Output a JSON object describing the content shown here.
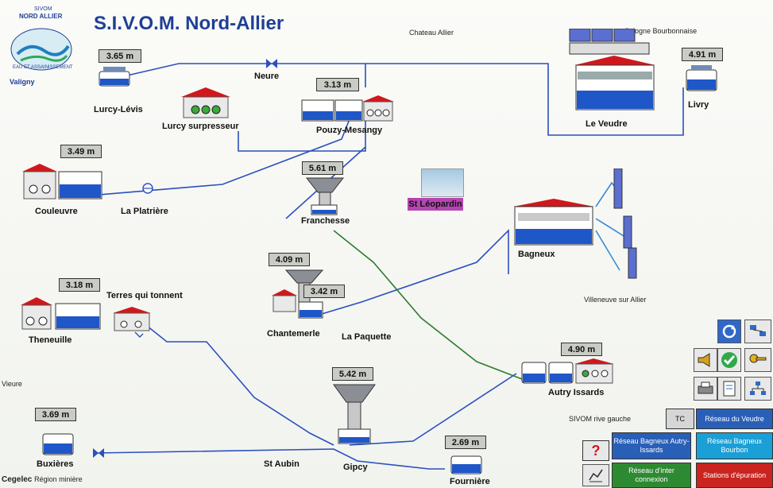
{
  "app": {
    "title": "S.I.V.O.M. Nord-Allier",
    "logo_lines": [
      "SIVOM",
      "NORD ALLIER",
      "EAU ET ASSAINISSEMENT"
    ],
    "logo_caption": "Valigny",
    "vendor": "Cegelec",
    "vendor_region": "Région minière"
  },
  "places": {
    "chateau_allier": "Chateau Allier",
    "sologne": "Sologne Bourbonnaise",
    "villeneuve": "Villeneuve sur Allier",
    "vieure": "Vieure",
    "sivom_left": "SIVOM rive gauche"
  },
  "sites": {
    "lurcy_levis": {
      "name": "Lurcy-Lévis",
      "level": "3.65 m"
    },
    "neure": {
      "name": "Neure"
    },
    "lurcy_surpresseur": {
      "name": "Lurcy surpresseur"
    },
    "pouzy": {
      "name": "Pouzy-Mesangy",
      "level": "3.13 m"
    },
    "le_veudre": {
      "name": "Le Veudre"
    },
    "livry": {
      "name": "Livry",
      "level": "4.91 m"
    },
    "couleuvre": {
      "name": "Couleuvre",
      "level": "3.49 m"
    },
    "la_platriere": {
      "name": "La Platrière"
    },
    "franchesse": {
      "name": "Franchesse",
      "level": "5.61 m"
    },
    "st_leopardin": {
      "name": "St Léopardin"
    },
    "bagneux": {
      "name": "Bagneux"
    },
    "chantemerle": {
      "name": "Chantemerle",
      "level": "4.09 m"
    },
    "la_paquette": {
      "name": "La Paquette",
      "level": "3.42 m"
    },
    "theneuille": {
      "name": "Theneuille",
      "level": "3.18 m"
    },
    "terres": {
      "name": "Terres qui tonnent"
    },
    "autry": {
      "name": "Autry Issards",
      "level": "4.90 m"
    },
    "gipcy": {
      "name": "Gipcy",
      "level": "5.42 m"
    },
    "st_aubin": {
      "name": "St Aubin"
    },
    "buxieres": {
      "name": "Buxières",
      "level": "3.69 m"
    },
    "fourniere": {
      "name": "Fournière",
      "level": "2.69 m"
    }
  },
  "nav": {
    "tc": "TC",
    "reseau_veudre": "Réseau du Veudre",
    "reseau_bagneux_autry": "Réseau Bagneux Autry-Issards",
    "reseau_bagneux_bourbon": "Réseau Bagneux Bourbon",
    "reseau_interconnexion": "Réseau d'inter connexion",
    "stations_epuration": "Stations d'épuration",
    "help_glyph": "?"
  },
  "colors": {
    "pipe_blue": "#2b4fbf",
    "pipe_light": "#3a8ad8",
    "pipe_green": "#2e7d2e",
    "title": "#1f3f96",
    "leopardin_bg": "#b545b3"
  }
}
